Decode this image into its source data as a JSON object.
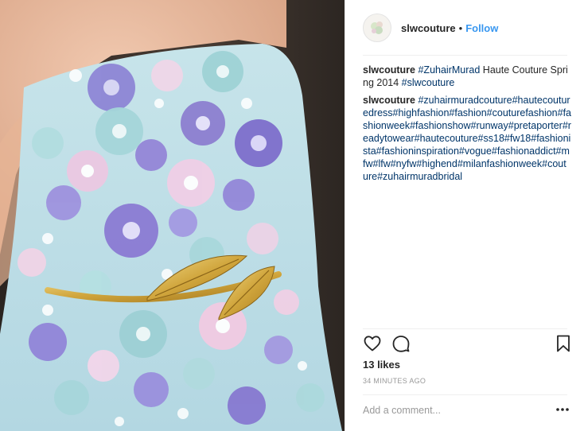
{
  "post": {
    "username": "slwcouture",
    "separator": "•",
    "follow_label": "Follow",
    "likes_text": "13 likes",
    "time_ago": "34 MINUTES AGO",
    "comment_placeholder": "Add a comment...",
    "image_alt": "photo",
    "avatar_alt": "slwcouture profile picture"
  },
  "comments": [
    {
      "user": "slwcouture",
      "parts": [
        {
          "type": "link",
          "text": "#ZuhairMurad"
        },
        {
          "type": "text",
          "text": " Haute Couture Spring 2014 "
        },
        {
          "type": "link",
          "text": "#slwcouture"
        }
      ]
    },
    {
      "user": "slwcouture",
      "parts": [
        {
          "type": "link",
          "text": "#zuhairmuradcouture#hautecouturedress#highfashion#fashion#couturefashion#fashionweek#fashionshow#runway#pretaporter#readytowear#hautecouture#ss18#fw18#fashionista#fashioninspiration#vogue#fashionaddict#mfw#lfw#nyfw#highend#milanfashionweek#couture#zuhairmuradbridal"
        }
      ]
    }
  ],
  "icons": {
    "like": "heart-icon",
    "comment": "comment-icon",
    "save": "bookmark-icon",
    "more": "more-options-icon"
  },
  "colors": {
    "link": "#003569",
    "follow": "#3897f0",
    "muted": "#999999",
    "text": "#262626"
  }
}
